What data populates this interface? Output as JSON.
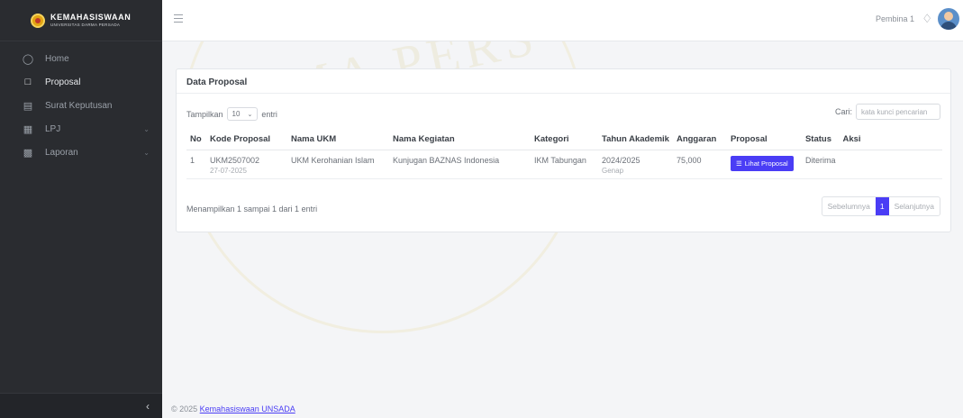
{
  "brand": {
    "title": "KEMAHASISWAAN",
    "subtitle": "UNIVERSITAS DARMA PERSADA"
  },
  "sidebar": {
    "items": [
      {
        "label": "Home",
        "icon": "dashboard-icon",
        "has_submenu": false,
        "active": false
      },
      {
        "label": "Proposal",
        "icon": "document-icon",
        "has_submenu": false,
        "active": true
      },
      {
        "label": "Surat Keputusan",
        "icon": "inbox-icon",
        "has_submenu": false,
        "active": false
      },
      {
        "label": "LPJ",
        "icon": "report-icon",
        "has_submenu": true,
        "active": false
      },
      {
        "label": "Laporan",
        "icon": "printer-icon",
        "has_submenu": true,
        "active": false
      }
    ],
    "collapse_icon": "chevron-left-icon"
  },
  "topbar": {
    "menu_icon": "hamburger-icon",
    "user_name": "Pembina 1",
    "bell_icon": "bell-icon"
  },
  "card": {
    "title": "Data Proposal",
    "show_prefix": "Tampilkan",
    "page_size": "10",
    "show_suffix": "entri",
    "search_label": "Cari:",
    "search_placeholder": "kata kunci pencarian"
  },
  "table": {
    "headers": [
      "No",
      "Kode Proposal",
      "Nama UKM",
      "Nama Kegiatan",
      "Kategori",
      "Tahun Akademik",
      "Anggaran",
      "Proposal",
      "Status",
      "Aksi"
    ],
    "rows": [
      {
        "no": "1",
        "kode": "UKM2507002",
        "tanggal": "27-07-2025",
        "ukm": "UKM Kerohanian Islam",
        "kegiatan": "Kunjugan BAZNAS Indonesia",
        "kategori": "IKM Tabungan",
        "tahun": "2024/2025",
        "semester": "Genap",
        "anggaran": "75,000",
        "proposal_btn": "Lihat Proposal",
        "status": "Diterima",
        "aksi": ""
      }
    ]
  },
  "info_text": "Menampilkan 1 sampai 1 dari 1 entri",
  "pager": {
    "prev": "Sebelumnya",
    "current": "1",
    "next": "Selanjutnya"
  },
  "footer": {
    "prefix": "© 2025",
    "link": "Kemahasiswaan UNSADA"
  },
  "colors": {
    "sidebar_bg": "#2a2c30",
    "accent": "#4a3df5",
    "page_bg": "#f4f5f7"
  }
}
